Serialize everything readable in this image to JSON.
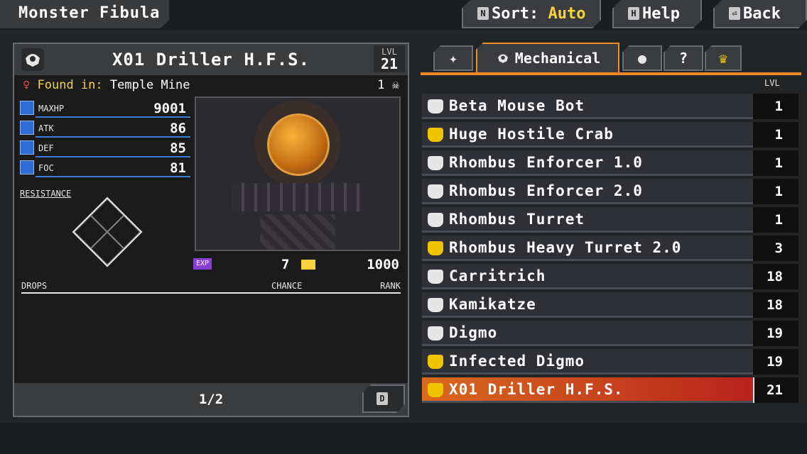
{
  "header": {
    "title": "Monster Fibula",
    "sort_key": "N",
    "sort_label": "Sort:",
    "sort_value": "Auto",
    "help_key": "H",
    "help_label": "Help",
    "back_key": "⏎",
    "back_label": "Back"
  },
  "detail": {
    "name": "X01 Driller H.F.S.",
    "lvl_label": "LVL",
    "lvl": "21",
    "found_label": "Found in:",
    "found_place": "Temple Mine",
    "kills": "1",
    "stats": [
      {
        "name": "MAXHP",
        "value": "9001"
      },
      {
        "name": "ATK",
        "value": "86"
      },
      {
        "name": "DEF",
        "value": "85"
      },
      {
        "name": "FOC",
        "value": "81"
      }
    ],
    "resistance_label": "RESISTANCE",
    "exp_badge": "EXP",
    "money": "7",
    "exp": "1000",
    "drops_header": {
      "drops": "DROPS",
      "chance": "CHANCE",
      "rank": "RANK"
    },
    "page": "1/2",
    "page_key": "D"
  },
  "tabs": {
    "active_label": "Mechanical",
    "other_icon_3": "?"
  },
  "list": {
    "lvl_header": "LVL",
    "items": [
      {
        "name": "Beta Mouse Bot",
        "lvl": "1",
        "icon": "white"
      },
      {
        "name": "Huge Hostile Crab",
        "lvl": "1",
        "icon": "gold"
      },
      {
        "name": "Rhombus Enforcer 1.0",
        "lvl": "1",
        "icon": "white"
      },
      {
        "name": "Rhombus Enforcer 2.0",
        "lvl": "1",
        "icon": "white"
      },
      {
        "name": "Rhombus Turret",
        "lvl": "1",
        "icon": "white"
      },
      {
        "name": "Rhombus Heavy Turret 2.0",
        "lvl": "3",
        "icon": "gold"
      },
      {
        "name": "Carritrich",
        "lvl": "18",
        "icon": "white"
      },
      {
        "name": "Kamikatze",
        "lvl": "18",
        "icon": "white"
      },
      {
        "name": "Digmo",
        "lvl": "19",
        "icon": "white"
      },
      {
        "name": "Infected Digmo",
        "lvl": "19",
        "icon": "gold"
      },
      {
        "name": "X01 Driller H.F.S.",
        "lvl": "21",
        "icon": "gold",
        "selected": true
      }
    ]
  },
  "colors": {
    "accent_orange": "#f08a24",
    "highlight_yellow": "#f6d23c",
    "stat_blue": "#2d6bd6"
  }
}
